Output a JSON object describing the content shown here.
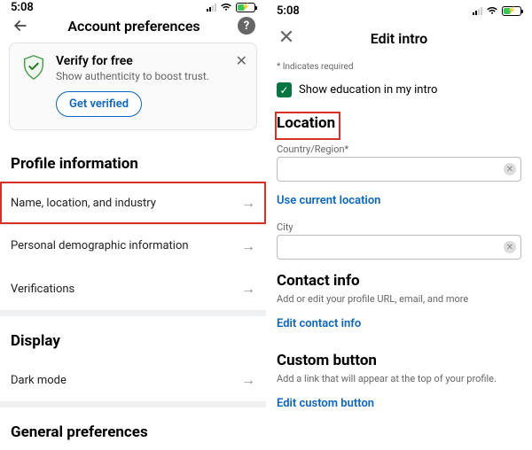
{
  "status": {
    "time": "5:08"
  },
  "left": {
    "title": "Account preferences",
    "verify": {
      "title": "Verify for free",
      "subtitle": "Show authenticity to boost trust.",
      "cta": "Get verified"
    },
    "profile_info_title": "Profile information",
    "rows": {
      "name_loc_industry": "Name, location, and industry",
      "demographic": "Personal demographic information",
      "verifications": "Verifications"
    },
    "display_title": "Display",
    "dark_mode": "Dark mode",
    "general_prefs_title": "General preferences"
  },
  "right": {
    "title": "Edit intro",
    "req_note": "* Indicates required",
    "show_edu": "Show education in my intro",
    "location_title": "Location",
    "country_label": "Country/Region*",
    "use_current": "Use current location",
    "city_label": "City",
    "contact_title": "Contact info",
    "contact_sub": "Add or edit your profile URL, email, and more",
    "edit_contact": "Edit contact info",
    "custom_title": "Custom button",
    "custom_sub": "Add a link that will appear at the top of your profile.",
    "edit_custom": "Edit custom button"
  }
}
